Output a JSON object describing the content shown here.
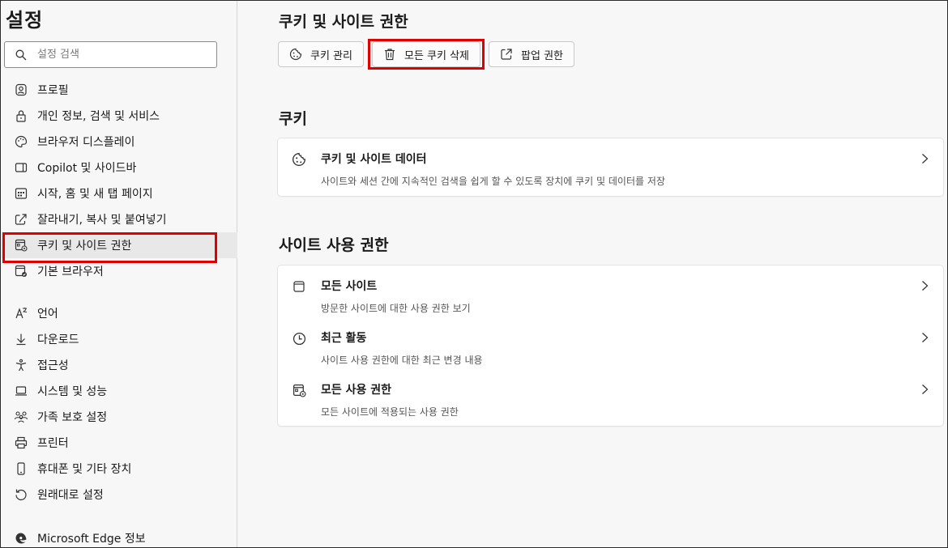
{
  "sidebar": {
    "title": "설정",
    "search_placeholder": "설정 검색",
    "items": [
      {
        "label": "프로필",
        "icon": "profile-icon"
      },
      {
        "label": "개인 정보, 검색 및 서비스",
        "icon": "lock-icon"
      },
      {
        "label": "브라우저 디스플레이",
        "icon": "palette-icon"
      },
      {
        "label": "Copilot 및 사이드바",
        "icon": "sidebar-icon"
      },
      {
        "label": "시작, 홈 및 새 탭 페이지",
        "icon": "home-grid-icon"
      },
      {
        "label": "잘라내기, 복사 및 붙여넣기",
        "icon": "share-icon"
      },
      {
        "label": "쿠키 및 사이트 권한",
        "icon": "site-permissions-icon"
      },
      {
        "label": "기본 브라우저",
        "icon": "default-browser-icon"
      },
      {
        "label": "언어",
        "icon": "language-icon"
      },
      {
        "label": "다운로드",
        "icon": "download-icon"
      },
      {
        "label": "접근성",
        "icon": "accessibility-icon"
      },
      {
        "label": "시스템 및 성능",
        "icon": "laptop-icon"
      },
      {
        "label": "가족 보호 설정",
        "icon": "family-icon"
      },
      {
        "label": "프린터",
        "icon": "printer-icon"
      },
      {
        "label": "휴대폰 및 기타 장치",
        "icon": "phone-icon"
      },
      {
        "label": "원래대로 설정",
        "icon": "reset-icon"
      },
      {
        "label": "Microsoft Edge 정보",
        "icon": "edge-icon"
      }
    ],
    "active_index": 6
  },
  "main": {
    "page_title": "쿠키 및 사이트 권한",
    "toolbar": {
      "manage_cookies": "쿠키 관리",
      "delete_all_cookies": "모든 쿠키 삭제",
      "popup_permissions": "팝업 권한"
    },
    "cookies_section": {
      "title": "쿠키",
      "rows": [
        {
          "title": "쿠키 및 사이트 데이터",
          "desc": "사이트와 세션 간에 지속적인 검색을 쉽게 할 수 있도록 장치에 쿠키 및 데이터를 저장",
          "icon": "cookie-icon"
        }
      ]
    },
    "permissions_section": {
      "title": "사이트 사용 권한",
      "rows": [
        {
          "title": "모든 사이트",
          "desc": "방문한 사이트에 대한 사용 권한 보기",
          "icon": "window-icon"
        },
        {
          "title": "최근 활동",
          "desc": "사이트 사용 권한에 대한 최근 변경 내용",
          "icon": "clock-icon"
        },
        {
          "title": "모든 사용 권한",
          "desc": "모든 사이트에 적용되는 사용 권한",
          "icon": "site-permissions-icon"
        }
      ]
    }
  },
  "colors": {
    "highlight": "#e00000",
    "background": "#f7f7f7",
    "card": "#ffffff"
  }
}
